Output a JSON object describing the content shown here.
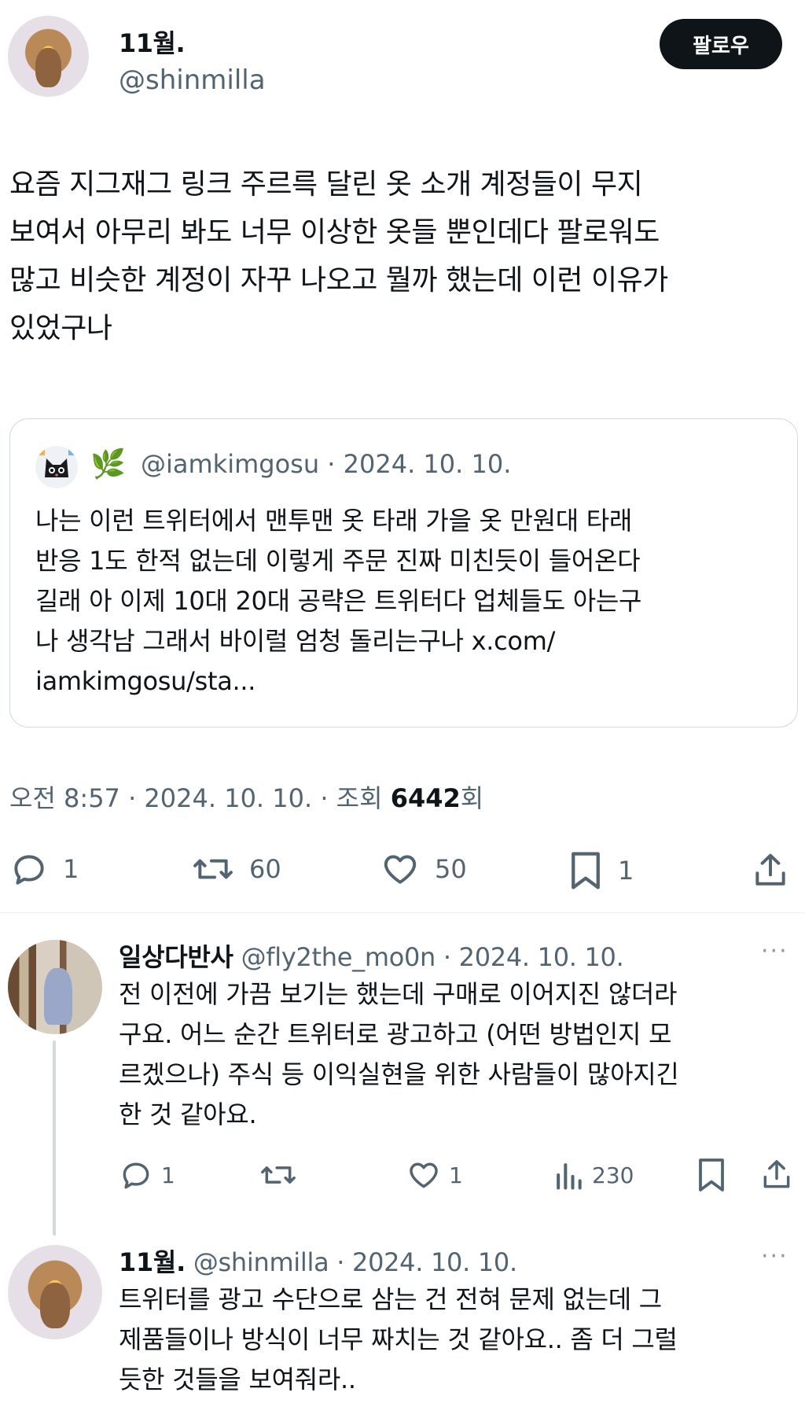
{
  "tweet": {
    "display_name": "11월.",
    "handle": "@shinmilla",
    "follow_label": "팔로우",
    "text": "요즘 지그재그 링크 주르륵 달린 옷 소개 계정들이 무지\n보여서 아무리 봐도 너무 이상한 옷들 뿐인데다 팔로워도\n많고 비슷한 계정이 자꾸 나오고 뭘까 했는데 이런 이유가\n있었구나",
    "quote": {
      "emoji": "🌿",
      "handle_date": "@iamkimgosu · 2024. 10. 10.",
      "text": "나는 이런 트위터에서 맨투맨 옷 타래 가을 옷 만원대 타래\n반응 1도 한적 없는데 이렇게 주문 진짜 미친듯이 들어온다\n길래 아 이제 10대 20대 공략은 트위터다 업체들도 아는구\n나 생각남 그래서 바이럴 엄청 돌리는구나 x.com/\niamkimgosu/sta..."
    },
    "meta_prefix": "오전 8:57 · 2024. 10. 10. · 조회 ",
    "views": "6442",
    "views_suffix": "회",
    "actions": {
      "replies": "1",
      "retweets": "60",
      "likes": "50",
      "bookmarks": "1"
    }
  },
  "replies": [
    {
      "display_name": "일상다반사",
      "handle_date": "@fly2the_mo0n · 2024. 10. 10.",
      "more": "···",
      "text": "전 이전에 가끔 보기는 했는데 구매로 이어지진 않더라\n구요. 어느 순간 트위터로 광고하고 (어떤 방법인지 모\n르겠으나) 주식 등 이익실현을 위한 사람들이 많아지긴\n한 것 같아요.",
      "actions": {
        "replies": "1",
        "retweets": "",
        "likes": "1",
        "views": "230"
      }
    },
    {
      "display_name": "11월.",
      "handle_date": "@shinmilla · 2024. 10. 10.",
      "more": "···",
      "text": "트위터를 광고 수단으로 삼는 건 전혀 문제 없는데 그\n제품들이나 방식이 너무 짜치는 것 같아요.. 좀 더 그럴\n듯한 것들을 보여줘라.."
    }
  ]
}
